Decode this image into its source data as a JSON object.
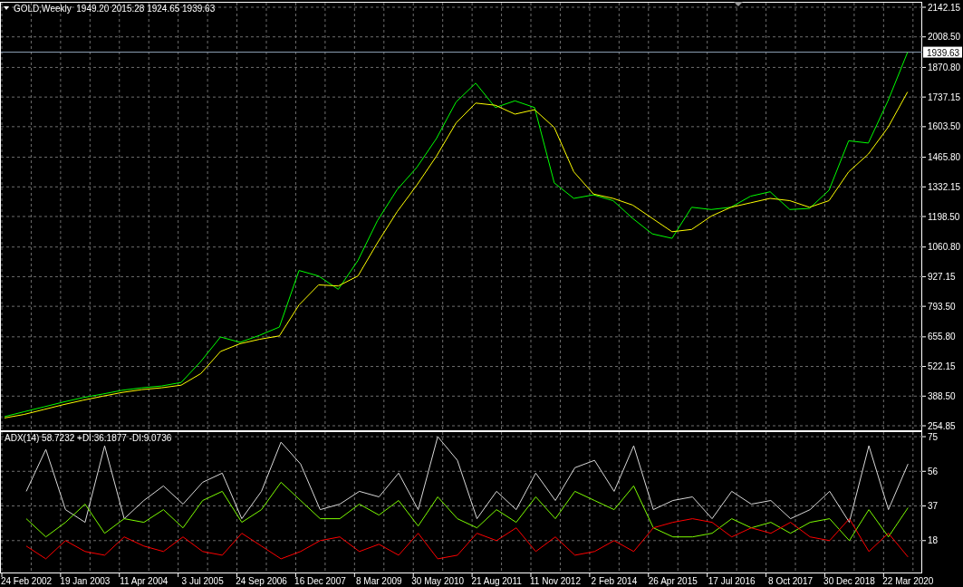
{
  "price_pane": {
    "chart_data": {
      "type": "line",
      "title": "GOLD,Weekly  1949.20 2015.28 1924.65 1939.63",
      "grid": true,
      "ref_lines": [
        {
          "axis": "y",
          "value": 1939.63,
          "label": "1939.63",
          "color": "#8fa3b8"
        }
      ],
      "series": [
        {
          "color": "#00ff00",
          "values": [
            296,
            318,
            340,
            362,
            382,
            398,
            415,
            426,
            434,
            450,
            545,
            655,
            631,
            663,
            700,
            955,
            930,
            870,
            1000,
            1180,
            1320,
            1420,
            1550,
            1715,
            1800,
            1690,
            1720,
            1690,
            1350,
            1280,
            1296,
            1270,
            1190,
            1120,
            1100,
            1240,
            1230,
            1240,
            1290,
            1310,
            1230,
            1235,
            1317,
            1540,
            1530,
            1720,
            1939
          ]
        },
        {
          "color": "#ffff00",
          "values": [
            290,
            306,
            328,
            350,
            370,
            388,
            405,
            418,
            426,
            438,
            490,
            590,
            625,
            645,
            660,
            800,
            890,
            885,
            930,
            1080,
            1220,
            1340,
            1470,
            1620,
            1710,
            1700,
            1660,
            1680,
            1600,
            1400,
            1300,
            1280,
            1250,
            1190,
            1130,
            1140,
            1200,
            1240,
            1260,
            1280,
            1270,
            1240,
            1270,
            1400,
            1480,
            1600,
            1760
          ]
        }
      ],
      "ylim": [
        254.85,
        2142.15
      ],
      "yticks": [
        {
          "value": 254.85,
          "label": "254.85"
        },
        {
          "value": 388.5,
          "label": "388.50"
        },
        {
          "value": 522.15,
          "label": "522.15"
        },
        {
          "value": 655.8,
          "label": "655.80"
        },
        {
          "value": 793.5,
          "label": "793.50"
        },
        {
          "value": 927.15,
          "label": "927.15"
        },
        {
          "value": 1060.8,
          "label": "1060.80"
        },
        {
          "value": 1198.5,
          "label": "1198.50"
        },
        {
          "value": 1332.15,
          "label": "1332.15"
        },
        {
          "value": 1465.8,
          "label": "1465.80"
        },
        {
          "value": 1603.5,
          "label": "1603.50"
        },
        {
          "value": 1737.15,
          "label": "1737.15"
        },
        {
          "value": 1870.8,
          "label": "1870.80"
        },
        {
          "value": 2008.5,
          "label": "2008.50"
        },
        {
          "value": 2142.15,
          "label": "2142.15"
        }
      ]
    }
  },
  "indicator_pane": {
    "chart_data": {
      "type": "line",
      "title": "ADX(14) 58.7232 +DI:36.1877 -DI:9.0736",
      "grid": true,
      "categories": [
        "24 Feb 2002",
        null,
        null,
        "19 Jan 2003",
        null,
        null,
        "11 Apr 2004",
        null,
        null,
        "3 Jul 2005",
        null,
        null,
        "24 Sep 2006",
        null,
        null,
        "16 Dec 2007",
        null,
        null,
        "8 Mar 2009",
        null,
        null,
        "30 May 2010",
        null,
        null,
        "21 Aug 2011",
        null,
        null,
        "11 Nov 2012",
        null,
        null,
        "2 Feb 2014",
        null,
        null,
        "26 Apr 2015",
        null,
        null,
        "17 Jul 2016",
        null,
        null,
        "8 Oct 2017",
        null,
        null,
        "30 Dec 2018",
        null,
        null,
        "22 Mar 2020"
      ],
      "series": [
        {
          "color": "#d8d8d8",
          "values": [
            45,
            68,
            35,
            28,
            70,
            30,
            40,
            48,
            38,
            50,
            55,
            30,
            45,
            72,
            60,
            35,
            38,
            45,
            42,
            55,
            35,
            75,
            62,
            30,
            45,
            35,
            55,
            40,
            58,
            62,
            45,
            70,
            35,
            40,
            42,
            30,
            45,
            38,
            40,
            30,
            35,
            45,
            28,
            70,
            35,
            60
          ]
        },
        {
          "color": "#7cfc00",
          "values": [
            30,
            20,
            28,
            38,
            22,
            30,
            28,
            35,
            25,
            40,
            45,
            28,
            35,
            50,
            40,
            30,
            30,
            38,
            32,
            40,
            26,
            42,
            30,
            25,
            35,
            28,
            42,
            30,
            45,
            40,
            35,
            48,
            25,
            20,
            20,
            22,
            30,
            25,
            28,
            22,
            28,
            30,
            18,
            35,
            20,
            36
          ]
        },
        {
          "color": "#ff0000",
          "values": [
            15,
            8,
            18,
            12,
            10,
            20,
            15,
            12,
            20,
            12,
            10,
            22,
            15,
            8,
            12,
            18,
            20,
            12,
            16,
            10,
            22,
            8,
            10,
            22,
            18,
            25,
            12,
            20,
            10,
            12,
            18,
            12,
            25,
            28,
            30,
            28,
            20,
            25,
            22,
            28,
            20,
            18,
            30,
            12,
            22,
            9
          ]
        }
      ],
      "ylim": [
        0,
        78
      ],
      "yticks": [
        18,
        37,
        56,
        75
      ]
    }
  }
}
